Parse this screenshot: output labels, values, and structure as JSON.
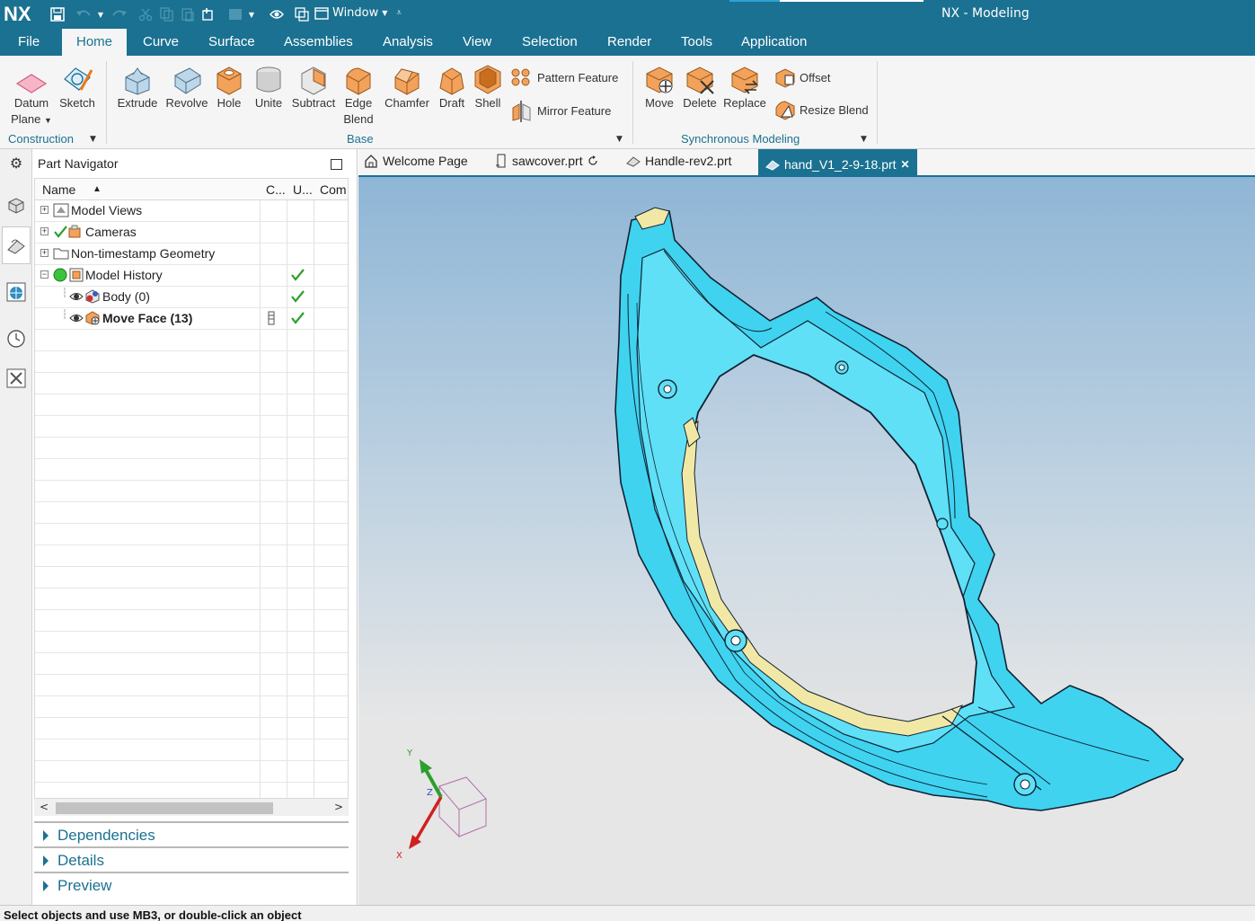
{
  "app": {
    "logo": "NX",
    "title": "NX - Modeling",
    "window_menu": "Window",
    "quick_access_icons": [
      "save-icon",
      "undo-icon",
      "redo-icon",
      "cut-icon",
      "copy-icon",
      "paste-icon",
      "repeat-command-icon",
      "touch-mode-icon",
      "customize-icon",
      "window-icon"
    ]
  },
  "menu": {
    "tabs": [
      "File",
      "Home",
      "Curve",
      "Surface",
      "Assemblies",
      "Analysis",
      "View",
      "Selection",
      "Render",
      "Tools",
      "Application"
    ],
    "active": "Home"
  },
  "ribbon": {
    "construction": {
      "label": "Construction",
      "datum_plane_line1": "Datum",
      "datum_plane_line2": "Plane",
      "sketch": "Sketch"
    },
    "base": {
      "label": "Base",
      "extrude": "Extrude",
      "revolve": "Revolve",
      "hole": "Hole",
      "unite": "Unite",
      "subtract": "Subtract",
      "edge_blend_line1": "Edge",
      "edge_blend_line2": "Blend",
      "chamfer": "Chamfer",
      "draft": "Draft",
      "shell": "Shell",
      "pattern_feature": "Pattern Feature",
      "mirror_feature": "Mirror Feature"
    },
    "synchronous": {
      "label": "Synchronous Modeling",
      "move": "Move",
      "delete": "Delete",
      "replace": "Replace",
      "offset": "Offset",
      "resize_blend": "Resize Blend"
    },
    "accent_color": "#1b7191"
  },
  "navigator": {
    "title": "Part Navigator",
    "columns": [
      "Name",
      "C...",
      "U...",
      "Com"
    ],
    "rows": [
      {
        "label": "Model Views",
        "expander": "+",
        "check": ""
      },
      {
        "label": "Cameras",
        "expander": "+",
        "check": ""
      },
      {
        "label": "Non-timestamp Geometry",
        "expander": "+",
        "check": ""
      },
      {
        "label": "Model History",
        "expander": "−",
        "check": "✓"
      },
      {
        "label": "Body (0)",
        "expander": "",
        "check": "✓"
      },
      {
        "label": "Move Face (13)",
        "expander": "",
        "check": "✓"
      }
    ],
    "panels": [
      "Dependencies",
      "Details",
      "Preview"
    ]
  },
  "doctabs": [
    {
      "label": "Welcome Page",
      "active": false
    },
    {
      "label": "sawcover.prt",
      "active": false
    },
    {
      "label": "Handle-rev2.prt",
      "active": false
    },
    {
      "label": "hand_V1_2-9-18.prt",
      "active": true,
      "close": "✕"
    }
  ],
  "triad": {
    "x": "X",
    "y": "Y",
    "z": "Z"
  },
  "status": "Select objects and use MB3, or double-click an object"
}
